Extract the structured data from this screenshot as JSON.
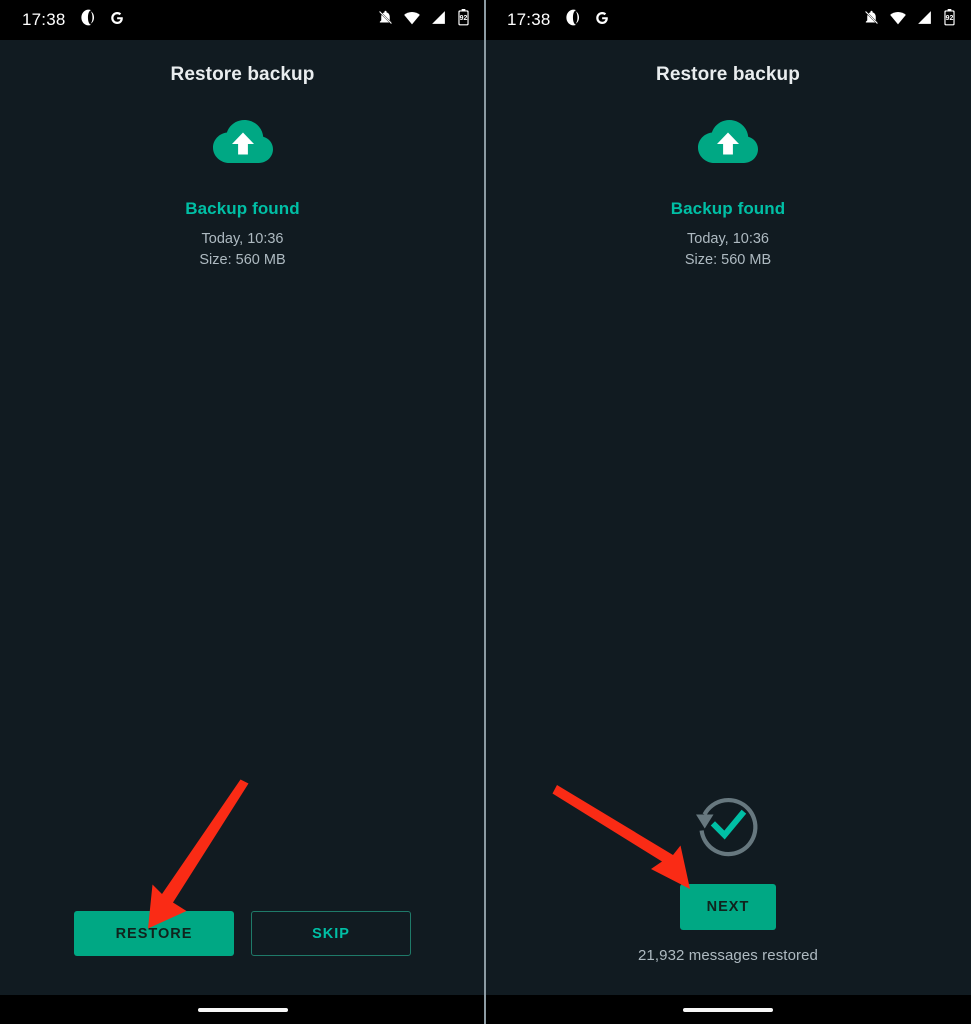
{
  "meta": {
    "colors": {
      "background": "#111b21",
      "accent_teal": "#00a884",
      "accent_teal_text": "#00bfa5",
      "status_bar": "#000000",
      "secondary_text": "#aebac1",
      "primary_text": "#e9edef",
      "annotation_red": "#fa2b15",
      "divider": "#8c9ba3"
    }
  },
  "status_bar": {
    "clock": "17:38",
    "left_icons": [
      {
        "name": "opera-notification-icon",
        "glyph": "opera"
      },
      {
        "name": "google-notification-icon",
        "glyph": "G"
      }
    ],
    "right_icons": [
      {
        "name": "notifications-muted-icon"
      },
      {
        "name": "wifi-icon"
      },
      {
        "name": "cellular-signal-icon"
      },
      {
        "name": "battery-icon",
        "level": "92"
      }
    ]
  },
  "screens": [
    {
      "id": "restore-prompt",
      "title": "Restore backup",
      "cloud_icon": "cloud-upload-icon",
      "backup_status": "Backup found",
      "backup_date": "Today, 10:36",
      "backup_size": "Size: 560 MB",
      "buttons": [
        {
          "name": "restore-button",
          "label": "RESTORE",
          "style": "filled"
        },
        {
          "name": "skip-button",
          "label": "SKIP",
          "style": "outline"
        }
      ]
    },
    {
      "id": "restore-complete",
      "title": "Restore backup",
      "cloud_icon": "cloud-upload-icon",
      "backup_status": "Backup found",
      "backup_date": "Today, 10:36",
      "backup_size": "Size: 560 MB",
      "done_icon": "restore-complete-check-icon",
      "next_button": {
        "name": "next-button",
        "label": "NEXT",
        "style": "filled"
      },
      "restored_count": "21,932 messages restored"
    }
  ],
  "annotations": [
    {
      "name": "arrow-to-restore-button",
      "color": "#fa2b15"
    },
    {
      "name": "arrow-to-next-button",
      "color": "#fa2b15"
    }
  ],
  "nav_bar": {
    "gesture_pill": "home-gesture-pill"
  }
}
